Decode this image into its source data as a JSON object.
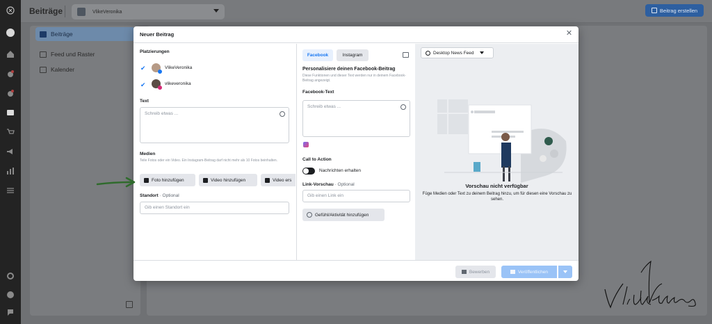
{
  "topbar": {
    "title": "Beiträge",
    "account": "VlikeVeronika",
    "create_label": "Beitrag erstellen"
  },
  "sidebar": {
    "items": [
      {
        "label": "Beiträge",
        "icon": "posts-icon"
      },
      {
        "label": "Feed und Raster",
        "icon": "feed-icon"
      },
      {
        "label": "Kalender",
        "icon": "calendar-icon"
      }
    ]
  },
  "modal": {
    "title": "Neuer Beitrag",
    "placements_label": "Platzierungen",
    "placements": [
      {
        "name": "VlikeVeronika",
        "network": "facebook"
      },
      {
        "name": "vlikeveronika",
        "network": "instagram"
      }
    ],
    "text_label": "Text",
    "text_placeholder": "Schreib etwas ...",
    "media_label": "Medien",
    "media_hint": "Teile Fotos oder ein Video. Ein Instagram-Beitrag darf nicht mehr als 10 Fotos beinhalten.",
    "media_buttons": [
      "Foto hinzufügen",
      "Video hinzufügen",
      "Video ers"
    ],
    "location_label": "Standort",
    "optional": "· Optional",
    "location_placeholder": "Gib einen Standort ein",
    "tabs": [
      "Facebook",
      "Instagram"
    ],
    "personalize_title": "Personalisiere deinen Facebook-Beitrag",
    "personalize_hint": "Diese Funktionen und dieser Text werden nur in deinem Facebook-Beitrag angezeigt.",
    "fb_text_label": "Facebook-Text",
    "fb_text_placeholder": "Schreib etwas ...",
    "cta_label": "Call to Action",
    "cta_toggle_label": "Nachrichten erhalten",
    "link_label": "Link-Vorschau",
    "link_optional": "· Optional",
    "link_placeholder": "Gib einen Link ein",
    "feeling_label": "Gefühl/Aktivität hinzufügen",
    "preview_dropdown": "Desktop News Feed",
    "preview_title": "Vorschau nicht verfügbar",
    "preview_text": "Füge Medien oder Text zu deinem Beitrag hinzu, um für diesen eine Vorschau zu sehen.",
    "boost_label": "Bewerben",
    "publish_label": "Veröffentlichen"
  },
  "colors": {
    "accent": "#1877f2",
    "overlay": "#6f7174",
    "preview_bg": "#eceef1"
  }
}
